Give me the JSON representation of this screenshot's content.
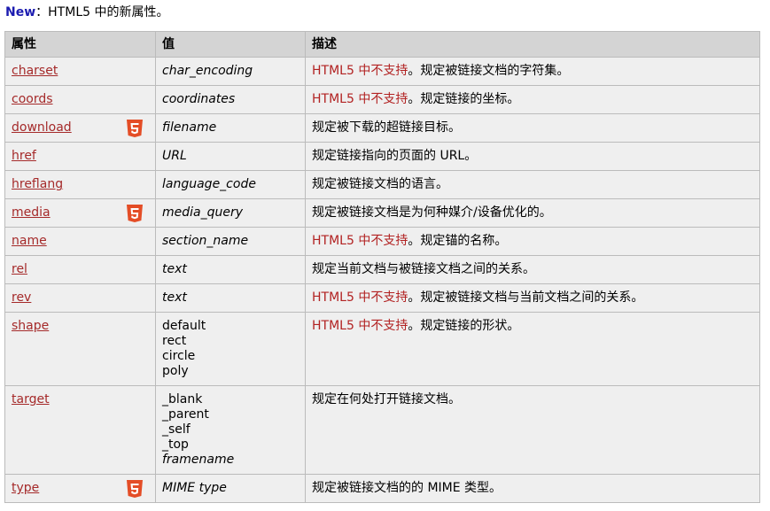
{
  "intro": {
    "new_label": "New",
    "text": "：HTML5 中的新属性。"
  },
  "colors": {
    "new_label": "#1c1cb0",
    "link": "#a52a2a",
    "not_supported": "#b22222",
    "header_bg": "#d4d4d4",
    "row_bg": "#efefef",
    "html5_badge": "#e44d26"
  },
  "table": {
    "headers": {
      "attribute": "属性",
      "value": "值",
      "description": "描述"
    },
    "not_supported_text": "HTML5 中不支持",
    "rows": [
      {
        "attr": "charset",
        "html5": false,
        "value": "char_encoding",
        "value_italic": true,
        "not_supported": true,
        "desc": "。规定被链接文档的字符集。"
      },
      {
        "attr": "coords",
        "html5": false,
        "value": "coordinates",
        "value_italic": true,
        "not_supported": true,
        "desc": "。规定链接的坐标。"
      },
      {
        "attr": "download",
        "html5": true,
        "value": "filename",
        "value_italic": true,
        "not_supported": false,
        "desc": "规定被下载的超链接目标。"
      },
      {
        "attr": "href",
        "html5": false,
        "value": "URL",
        "value_italic": true,
        "not_supported": false,
        "desc": "规定链接指向的页面的 URL。"
      },
      {
        "attr": "hreflang",
        "html5": false,
        "value": "language_code",
        "value_italic": true,
        "not_supported": false,
        "desc": "规定被链接文档的语言。"
      },
      {
        "attr": "media",
        "html5": true,
        "value": "media_query",
        "value_italic": true,
        "not_supported": false,
        "desc": "规定被链接文档是为何种媒介/设备优化的。"
      },
      {
        "attr": "name",
        "html5": false,
        "value": "section_name",
        "value_italic": true,
        "not_supported": true,
        "desc": "。规定锚的名称。"
      },
      {
        "attr": "rel",
        "html5": false,
        "value": "text",
        "value_italic": true,
        "not_supported": false,
        "desc": "规定当前文档与被链接文档之间的关系。"
      },
      {
        "attr": "rev",
        "html5": false,
        "value": "text",
        "value_italic": true,
        "not_supported": true,
        "desc": "。规定被链接文档与当前文档之间的关系。"
      },
      {
        "attr": "shape",
        "html5": false,
        "value_list": [
          "default",
          "rect",
          "circle",
          "poly"
        ],
        "not_supported": true,
        "desc": "。规定链接的形状。"
      },
      {
        "attr": "target",
        "html5": false,
        "value_list": [
          "_blank",
          "_parent",
          "_self",
          "_top",
          "framename"
        ],
        "value_list_italic_last": true,
        "not_supported": false,
        "desc": "规定在何处打开链接文档。"
      },
      {
        "attr": "type",
        "html5": true,
        "value": "MIME type",
        "value_italic": true,
        "not_supported": false,
        "desc": "规定被链接文档的的 MIME 类型。"
      }
    ]
  }
}
